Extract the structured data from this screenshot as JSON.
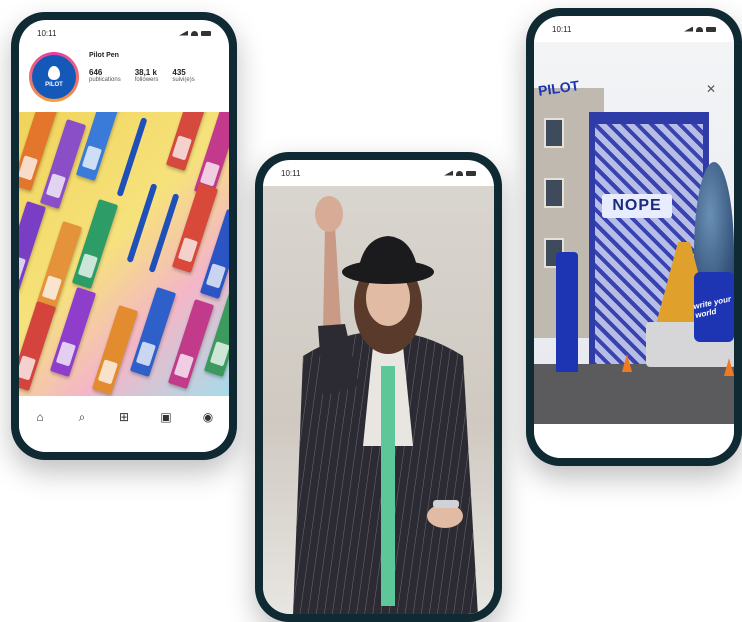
{
  "phones": {
    "left": {
      "time": "10:11",
      "profile": {
        "name": "Pilot Pen",
        "avatar_text": "PILOT",
        "stats": [
          {
            "value": "646",
            "label": "publications"
          },
          {
            "value": "38,1 k",
            "label": "followers"
          },
          {
            "value": "435",
            "label": "suivi(e)s"
          }
        ]
      },
      "nav_icons": [
        "home-icon",
        "search-icon",
        "add-icon",
        "shop-icon",
        "profile-icon"
      ]
    },
    "center": {
      "time": "10:11"
    },
    "right": {
      "time": "10:11",
      "mural_text": "NOPE",
      "sign_text": "PILOT",
      "board_text": "write your world"
    }
  },
  "colors": {
    "phone_frame": "#0f2a33",
    "pilot_blue": "#1e35b3",
    "instagram_ring": "#e63ca6"
  }
}
